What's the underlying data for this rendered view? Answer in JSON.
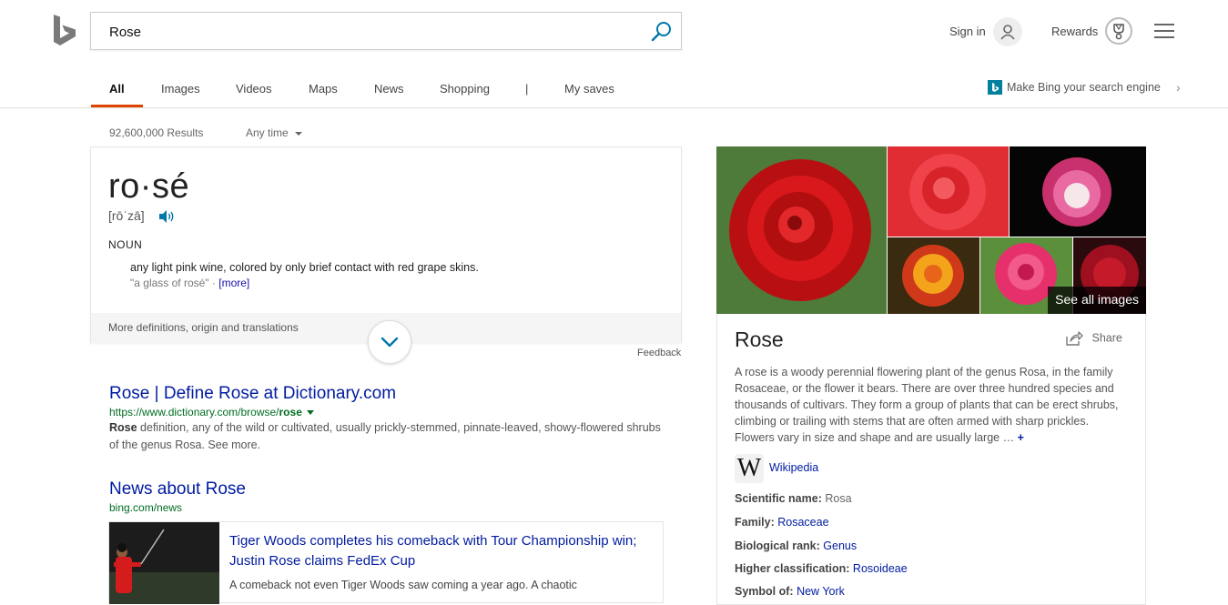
{
  "search": {
    "query": "Rose"
  },
  "header": {
    "sign_in": "Sign in",
    "rewards": "Rewards"
  },
  "nav": {
    "items": [
      {
        "label": "All",
        "active": true
      },
      {
        "label": "Images"
      },
      {
        "label": "Videos"
      },
      {
        "label": "Maps"
      },
      {
        "label": "News"
      },
      {
        "label": "Shopping"
      },
      {
        "label": "|"
      },
      {
        "label": "My saves"
      }
    ],
    "make_bing": "Make Bing your search engine"
  },
  "results_meta": {
    "count": "92,600,000 Results",
    "time_filter": "Any time"
  },
  "dictionary": {
    "word": "ro·sé",
    "pronunciation": "[rōˈzā]",
    "part_of_speech": "NOUN",
    "definition": "any light pink wine, colored by only brief contact with red grape skins.",
    "example": "\"a glass of rosé\" ·",
    "more_label": "[more]",
    "footer": "More definitions, origin and translations",
    "feedback": "Feedback"
  },
  "results": [
    {
      "title": "Rose | Define Rose at Dictionary.com",
      "url_prefix": "https://www.dictionary.com/browse/",
      "url_bold": "rose",
      "snippet_bold": "Rose",
      "snippet": " definition, any of the wild or cultivated, usually prickly-stemmed, pinnate-leaved, showy-flowered shrubs of the genus Rosa. See more."
    },
    {
      "title": "News about Rose",
      "url": "bing.com/news"
    }
  ],
  "news": {
    "headline": "Tiger Woods completes his comeback with Tour Championship win; Justin Rose claims FedEx Cup",
    "description": "A comeback not even Tiger Woods saw coming a year ago. A chaotic"
  },
  "knowledge_panel": {
    "see_all_images": "See all images",
    "title": "Rose",
    "share": "Share",
    "description": "A rose is a woody perennial flowering plant of the genus Rosa, in the family Rosaceae, or the flower it bears. There are over three hundred species and thousands of cultivars. They form a group of plants that can be erect shrubs, climbing or trailing with stems that are often armed with sharp prickles. Flowers vary in size and shape and are usually large …",
    "plus": "+",
    "wiki_glyph": "W",
    "wiki_label": "Wikipedia",
    "facts": [
      {
        "label": "Scientific name:",
        "value": "Rosa",
        "link": false
      },
      {
        "label": "Family:",
        "value": "Rosaceae",
        "link": true
      },
      {
        "label": "Biological rank:",
        "value": "Genus",
        "link": true
      },
      {
        "label": "Higher classification:",
        "value": "Rosoideae",
        "link": true
      },
      {
        "label": "Symbol of:",
        "value": "New York",
        "link": true
      }
    ]
  },
  "colors": {
    "accent": "#de4500",
    "link": "#001ba0",
    "url": "#006d21",
    "bing_teal": "#00809d"
  }
}
